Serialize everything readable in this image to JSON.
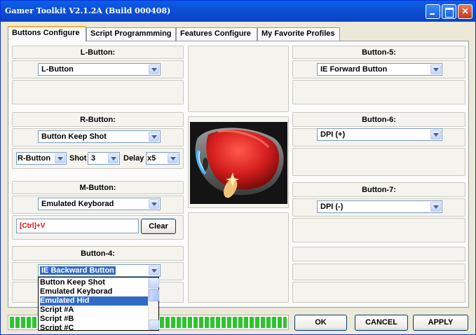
{
  "window": {
    "title": "Gamer Toolkit V2.1.2A (Build 000408)"
  },
  "tabs": [
    {
      "label": "Buttons Configure",
      "active": true
    },
    {
      "label": "Script Programmming",
      "active": false
    },
    {
      "label": "Features Configure",
      "active": false
    },
    {
      "label": "My Favorite Profiles",
      "active": false
    }
  ],
  "left": {
    "l_button": {
      "label": "L-Button:",
      "value": "L-Button"
    },
    "r_button": {
      "label": "R-Button:",
      "value": "Button Keep Shot",
      "sub_value": "R-Button",
      "shot_label": "Shot",
      "shot_value": "3",
      "delay_label": "Delay",
      "delay_value": "x5"
    },
    "m_button": {
      "label": "M-Button:",
      "value": "Emulated Keyborad",
      "key_text": "[Ctrl]+V",
      "clear_label": "Clear"
    },
    "button4": {
      "label": "Button-4:",
      "value": "IE Backward Button"
    }
  },
  "right": {
    "button5": {
      "label": "Button-5:",
      "value": "IE Forward Button"
    },
    "button6": {
      "label": "Button-6:",
      "value": "DPI (+)"
    },
    "button7": {
      "label": "Button-7:",
      "value": "DPI (-)"
    }
  },
  "dropdown_options": [
    "Button Keep Shot",
    "Emulated Keyborad",
    "Emulated Hid",
    "Script #A",
    "Script #B",
    "Script #C"
  ],
  "dropdown_selected_index": 2,
  "footer": {
    "ok_label": "OK",
    "cancel_label": "CANCEL",
    "apply_label": "APPLY"
  },
  "progress": {
    "left_fill": 1.0,
    "right_fill": 1.0
  },
  "colors": {
    "title_bar": "#0a5fe8",
    "selection": "#316ac5",
    "key_text": "#e01010",
    "progress": "#2dc52d",
    "mouse_body": "#d61e1e"
  }
}
